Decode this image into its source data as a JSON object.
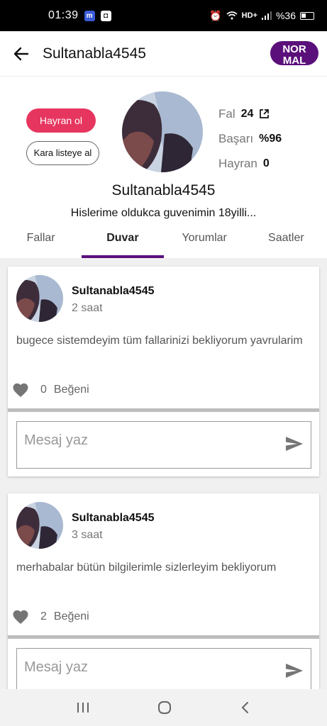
{
  "status_bar": {
    "time": "01:39",
    "app_icon_1": "m",
    "network": "HD+",
    "battery": "%36"
  },
  "appbar": {
    "back_icon": "arrow-left-icon",
    "title": "Sultanabla4545",
    "level_badge": "NOR MAL"
  },
  "profile": {
    "fan_button": "Hayran ol",
    "blacklist_button": "Kara listeye al",
    "stats": [
      {
        "label": "Fal",
        "value": "24"
      },
      {
        "label": "Başarı",
        "value": "%96"
      },
      {
        "label": "Hayran",
        "value": "0"
      }
    ],
    "name": "Sultanabla4545",
    "bio": "Hislerime oldukca guvenimin 18yilli..."
  },
  "tabs": [
    {
      "label": "Fallar",
      "active": false
    },
    {
      "label": "Duvar",
      "active": true
    },
    {
      "label": "Yorumlar",
      "active": false
    },
    {
      "label": "Saatler",
      "active": false
    }
  ],
  "posts": [
    {
      "author": "Sultanabla4545",
      "time": "2 saat",
      "text": "bugece sistemdeyim tüm fallarinizi bekliyorum yavrularim",
      "likes": "0",
      "likes_label": "Beğeni",
      "message_placeholder": "Mesaj yaz"
    },
    {
      "author": "Sultanabla4545",
      "time": "3 saat",
      "text": "merhabalar bütün bilgilerimle sizlerleyim bekliyorum",
      "likes": "2",
      "likes_label": "Beğeni",
      "message_placeholder": "Mesaj yaz"
    }
  ],
  "colors": {
    "accent_purple": "#5a0f7a",
    "fan_pink": "#e6365f"
  }
}
